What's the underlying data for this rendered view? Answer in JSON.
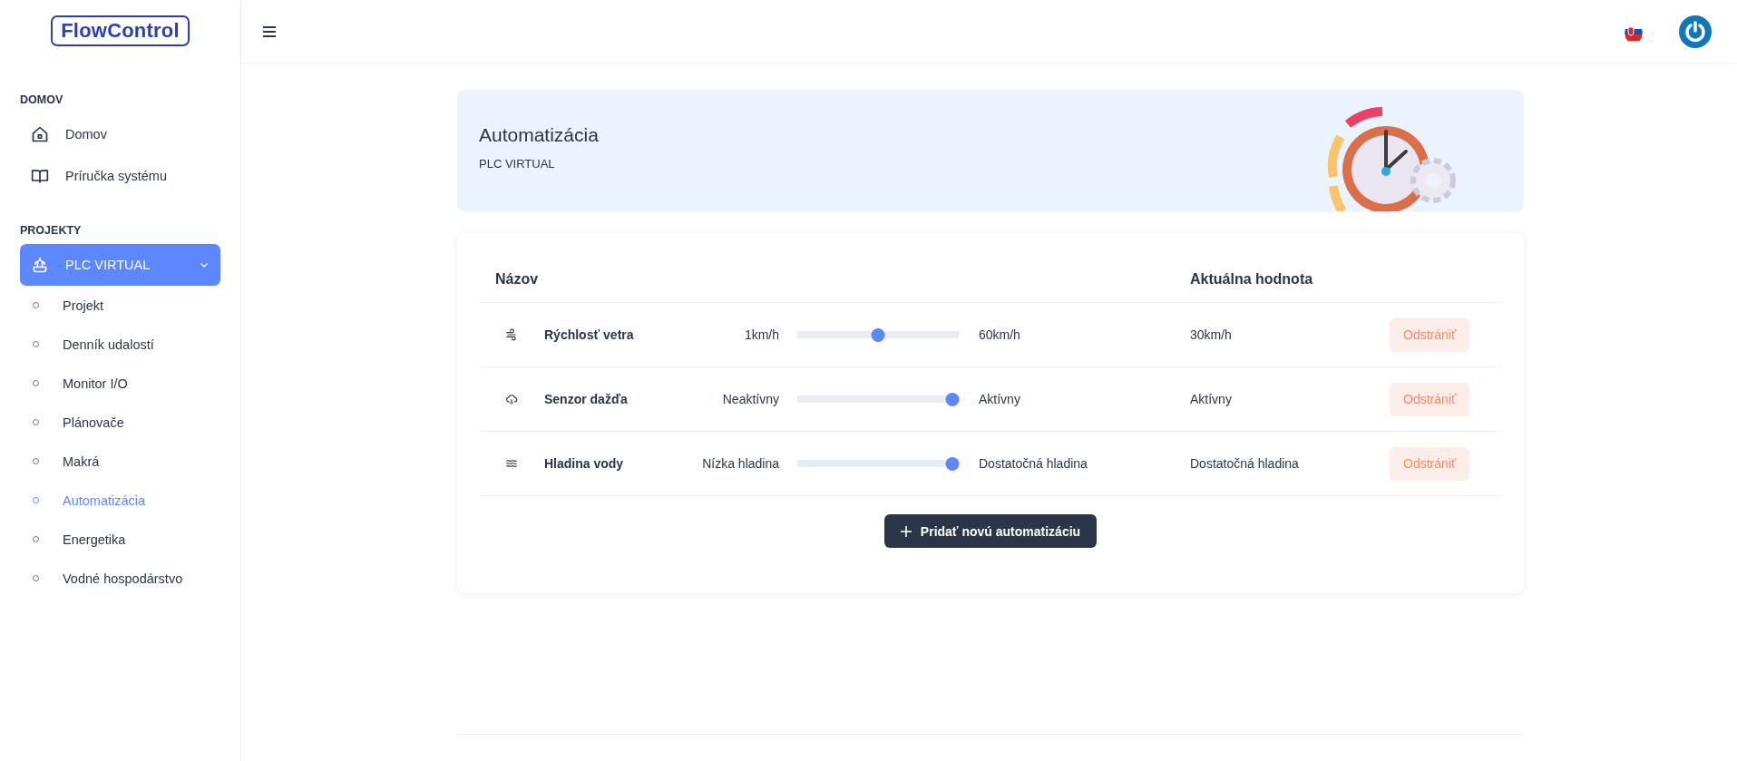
{
  "logo": "FlowControl",
  "sidebar": {
    "sections": [
      {
        "heading": "DOMOV",
        "items": [
          {
            "label": "Domov",
            "selected": false
          },
          {
            "label": "Príručka systému",
            "selected": false
          }
        ]
      },
      {
        "heading": "PROJEKTY",
        "items": [
          {
            "label": "PLC VIRTUAL",
            "selected": true,
            "expanded": true,
            "children": [
              {
                "label": "Projekt",
                "selected": false
              },
              {
                "label": "Denník udalostí",
                "selected": false
              },
              {
                "label": "Monitor I/O",
                "selected": false
              },
              {
                "label": "Plánovače",
                "selected": false
              },
              {
                "label": "Makrá",
                "selected": false
              },
              {
                "label": "Automatizácia",
                "selected": true
              },
              {
                "label": "Energetika",
                "selected": false
              },
              {
                "label": "Vodné hospodárstvo",
                "selected": false
              }
            ]
          }
        ]
      }
    ]
  },
  "banner": {
    "title": "Automatizácia",
    "subtitle": "PLC VIRTUAL"
  },
  "table": {
    "columns": [
      "Názov",
      "Aktuálna hodnota"
    ],
    "rows": [
      {
        "name": "Rýchlosť vetra",
        "min_label": "1km/h",
        "level": 0.5,
        "max_label": "60km/h",
        "value": "30km/h",
        "action": "Odstrániť"
      },
      {
        "name": "Senzor dažďa",
        "min_label": "Neaktívny",
        "level": 1,
        "max_label": "Aktívny",
        "value": "Aktívny",
        "action": "Odstrániť"
      },
      {
        "name": "Hladina vody",
        "min_label": "Nízka hladina",
        "level": 1,
        "max_label": "Dostatočná hladina",
        "value": "Dostatočná hladina",
        "action": "Odstrániť"
      }
    ]
  },
  "add_button": "Pridať novú automatizáciu"
}
